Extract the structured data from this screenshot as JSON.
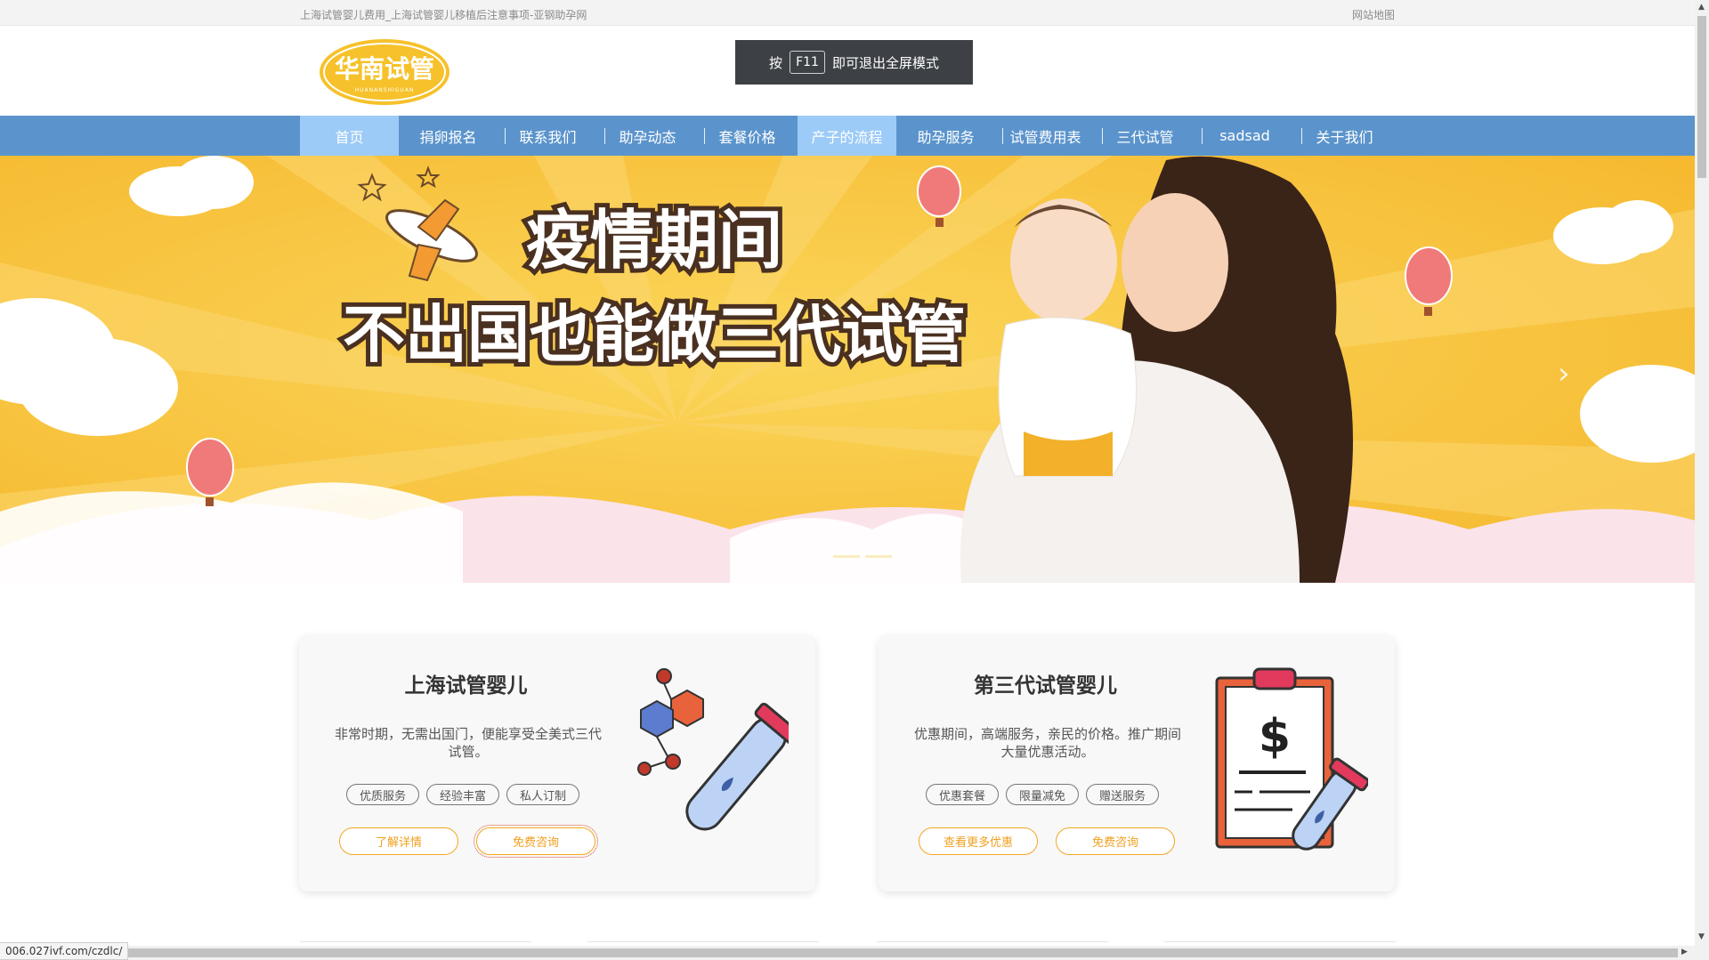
{
  "topbar": {
    "title": "上海试管婴儿费用_上海试管婴儿移植后注意事项-亚钢助孕网",
    "sitemap": "网站地图"
  },
  "logo": {
    "text": "华南试管",
    "subtext": "HUANANSHIGUAN"
  },
  "f11_toast": {
    "prefix": "按",
    "key": "F11",
    "suffix": "即可退出全屏模式"
  },
  "nav": {
    "items": [
      {
        "label": "首页"
      },
      {
        "label": "捐卵报名"
      },
      {
        "label": "联系我们"
      },
      {
        "label": "助孕动态"
      },
      {
        "label": "套餐价格"
      },
      {
        "label": "产子的流程"
      },
      {
        "label": "助孕服务"
      },
      {
        "label": "试管费用表"
      },
      {
        "label": "三代试管"
      },
      {
        "label": "sadsad"
      },
      {
        "label": "关于我们"
      }
    ]
  },
  "banner": {
    "headline1": "疫情期间",
    "headline2": "不出国也能做三代试管",
    "prev_label": "‹",
    "next_label": "›",
    "slide_count": 3,
    "active_slide": 1
  },
  "cards": [
    {
      "title": "上海试管婴儿",
      "desc": "非常时期，无需出国门，便能享受全美式三代试管。",
      "tags": [
        "优质服务",
        "经验丰富",
        "私人订制"
      ],
      "buttons": [
        "了解详情",
        "免费咨询"
      ]
    },
    {
      "title": "第三代试管婴儿",
      "desc": "优惠期间，高端服务，亲民的价格。推广期间大量优惠活动。",
      "tags": [
        "优惠套餐",
        "限量减免",
        "赠送服务"
      ],
      "buttons": [
        "查看更多优惠",
        "免费咨询"
      ]
    }
  ],
  "statusbar": {
    "url": "006.027ivf.com/czdlc/"
  },
  "colors": {
    "nav_bg": "#5b94cc",
    "nav_active": "#9ccbf7",
    "banner_yellow": "#f6b92e",
    "accent_orange": "#f5a623"
  }
}
